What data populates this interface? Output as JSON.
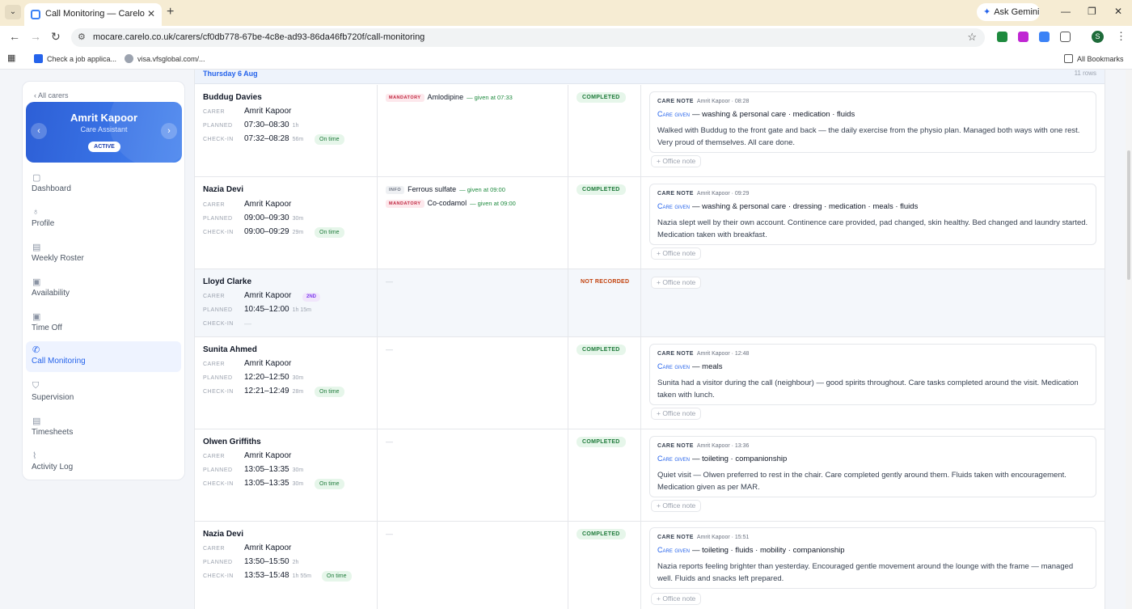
{
  "browser": {
    "tab_title": "Call Monitoring — Carelo",
    "url": "mocare.carelo.co.uk/carers/cf0db778-67be-4c8e-ad93-86da46fb720f/call-monitoring",
    "gemini_label": "Ask Gemini",
    "profile_initial": "S",
    "bookmarks": [
      "Check a job applica...",
      "visa.vfsglobal.com/...",
      "All Bookmarks"
    ]
  },
  "sidebar": {
    "back_link": "‹ All carers",
    "carer_name": "Amrit Kapoor",
    "carer_role": "Care Assistant",
    "carer_status": "ACTIVE",
    "nav": [
      {
        "label": "Dashboard",
        "icon": "dashboard-icon"
      },
      {
        "label": "Profile",
        "icon": "profile-icon"
      },
      {
        "label": "Weekly Roster",
        "icon": "roster-icon"
      },
      {
        "label": "Availability",
        "icon": "availability-icon"
      },
      {
        "label": "Time Off",
        "icon": "time-off-icon"
      },
      {
        "label": "Call Monitoring",
        "icon": "phone-icon"
      },
      {
        "label": "Supervision",
        "icon": "shield-icon"
      },
      {
        "label": "Timesheets",
        "icon": "timesheet-icon"
      },
      {
        "label": "Activity Log",
        "icon": "activity-icon"
      }
    ]
  },
  "table": {
    "day_label": "Thursday 6 Aug",
    "row_count": "11 rows",
    "labels": {
      "carer": "CARER",
      "planned": "PLANNED",
      "checkin": "CHECK-IN"
    },
    "office_note_label": "+ Office note",
    "note_label": "CARE NOTE",
    "care_given_label": "Care given",
    "dash": "—",
    "rows": [
      {
        "client": "Buddug Davies",
        "carer": "Amrit Kapoor",
        "planned": "07:30–08:30",
        "planned_dur": "1h",
        "checkin": "07:32–08:28",
        "checkin_dur": "56m",
        "timeliness": "On time",
        "meds": [
          {
            "tag": "MANDATORY",
            "name": "Amlodipine",
            "given": "— given at 07:33"
          }
        ],
        "status": "COMPLETED",
        "note_meta": "Amrit Kapoor · 08:28",
        "care": "— washing & personal care · medication · fluids",
        "note": "Walked with Buddug to the front gate and back — the daily exercise from the physio plan. Managed both ways with one rest. Very proud of themselves. All care done."
      },
      {
        "client": "Nazia Devi",
        "carer": "Amrit Kapoor",
        "planned": "09:00–09:30",
        "planned_dur": "30m",
        "checkin": "09:00–09:29",
        "checkin_dur": "29m",
        "timeliness": "On time",
        "meds": [
          {
            "tag": "INFO",
            "name": "Ferrous sulfate",
            "given": "— given at 09:00"
          },
          {
            "tag": "MANDATORY",
            "name": "Co-codamol",
            "given": "— given at 09:00"
          }
        ],
        "status": "COMPLETED",
        "note_meta": "Amrit Kapoor · 09:29",
        "care": "— washing & personal care · dressing · medication · meals · fluids",
        "note": "Nazia slept well by their own account. Continence care provided, pad changed, skin healthy. Bed changed and laundry started. Medication taken with breakfast."
      },
      {
        "client": "Lloyd Clarke",
        "carer": "Amrit Kapoor",
        "carer_badge": "2ND",
        "planned": "10:45–12:00",
        "planned_dur": "1h 15m",
        "checkin": "—",
        "status": "NOT RECORDED"
      },
      {
        "client": "Sunita Ahmed",
        "carer": "Amrit Kapoor",
        "planned": "12:20–12:50",
        "planned_dur": "30m",
        "checkin": "12:21–12:49",
        "checkin_dur": "28m",
        "timeliness": "On time",
        "status": "COMPLETED",
        "note_meta": "Amrit Kapoor · 12:48",
        "care": "— meals",
        "note": "Sunita had a visitor during the call (neighbour) — good spirits throughout. Care tasks completed around the visit. Medication taken with lunch."
      },
      {
        "client": "Olwen Griffiths",
        "carer": "Amrit Kapoor",
        "planned": "13:05–13:35",
        "planned_dur": "30m",
        "checkin": "13:05–13:35",
        "checkin_dur": "30m",
        "timeliness": "On time",
        "status": "COMPLETED",
        "note_meta": "Amrit Kapoor · 13:36",
        "care": "— toileting · companionship",
        "note": "Quiet visit — Olwen preferred to rest in the chair. Care completed gently around them. Fluids taken with encouragement. Medication given as per MAR."
      },
      {
        "client": "Nazia Devi",
        "carer": "Amrit Kapoor",
        "planned": "13:50–15:50",
        "planned_dur": "2h",
        "checkin": "13:53–15:48",
        "checkin_dur": "1h 55m",
        "timeliness": "On time",
        "status": "COMPLETED",
        "note_meta": "Amrit Kapoor · 15:51",
        "care": "— toileting · fluids · mobility · companionship",
        "note": "Nazia reports feeling brighter than yesterday. Encouraged gentle movement around the lounge with the frame — managed well. Fluids and snacks left prepared."
      }
    ]
  }
}
